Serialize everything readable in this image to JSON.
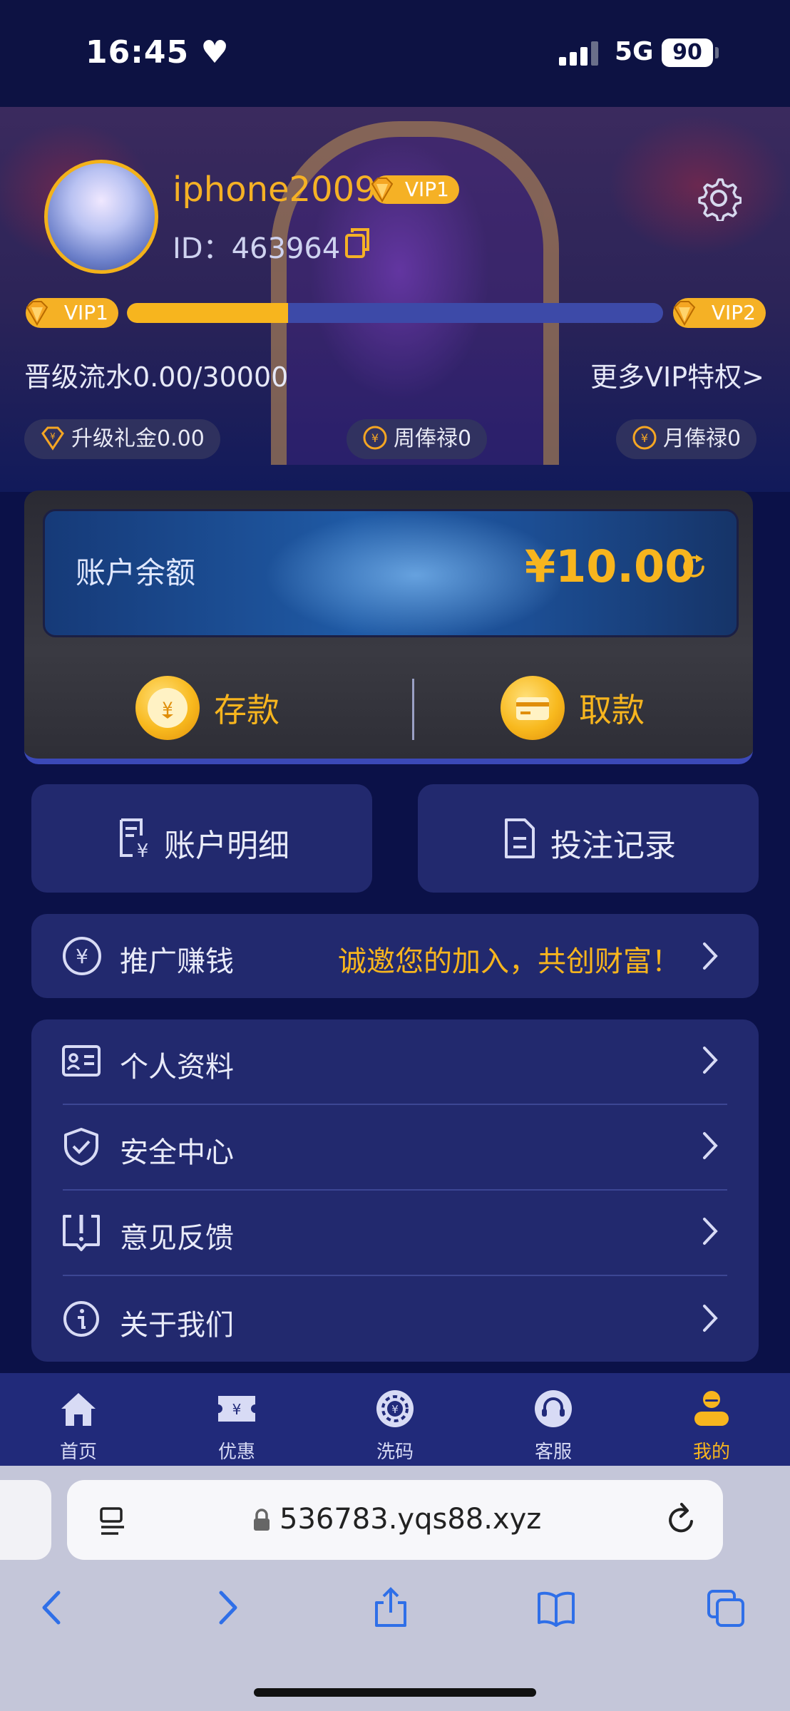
{
  "status_bar": {
    "time": "16:45",
    "heart": "♥",
    "network": "5G",
    "battery": "90"
  },
  "profile": {
    "username": "iphone2009",
    "vip_badge": "VIP1",
    "id_label": "ID：",
    "id_value": "463964"
  },
  "vip_progress": {
    "current_level": "VIP1",
    "next_level": "VIP2",
    "progress_fraction": 0.3,
    "turnover_text": "晋级流水0.00/30000",
    "more_link": "更多VIP特权>"
  },
  "rewards": [
    {
      "icon": "diamond-icon",
      "label": "升级礼金0.00"
    },
    {
      "icon": "yen-coin-icon",
      "label": "周俸禄0"
    },
    {
      "icon": "yen-coin-icon",
      "label": "月俸禄0"
    }
  ],
  "balance": {
    "label": "账户余额",
    "value": "¥10.00",
    "deposit": "存款",
    "withdraw": "取款"
  },
  "quick_actions": {
    "account_details": "账户明细",
    "bet_records": "投注记录"
  },
  "promo": {
    "label": "推广赚钱",
    "text": "诚邀您的加入，共创财富！"
  },
  "menu": [
    {
      "icon": "id-card-icon",
      "label": "个人资料"
    },
    {
      "icon": "shield-check-icon",
      "label": "安全中心"
    },
    {
      "icon": "feedback-icon",
      "label": "意见反馈"
    },
    {
      "icon": "info-icon",
      "label": "关于我们"
    }
  ],
  "tabbar": [
    {
      "label": "首页",
      "icon": "home-icon",
      "active": false
    },
    {
      "label": "优惠",
      "icon": "ticket-icon",
      "active": false
    },
    {
      "label": "洗码",
      "icon": "chip-icon",
      "active": false
    },
    {
      "label": "客服",
      "icon": "headset-icon",
      "active": false
    },
    {
      "label": "我的",
      "icon": "user-icon",
      "active": true
    }
  ],
  "browser": {
    "url": "536783.yqs88.xyz"
  },
  "colors": {
    "accent": "#f7b51e",
    "panel": "#22296e",
    "background": "#0b1148",
    "tabbar": "#212a7a"
  }
}
